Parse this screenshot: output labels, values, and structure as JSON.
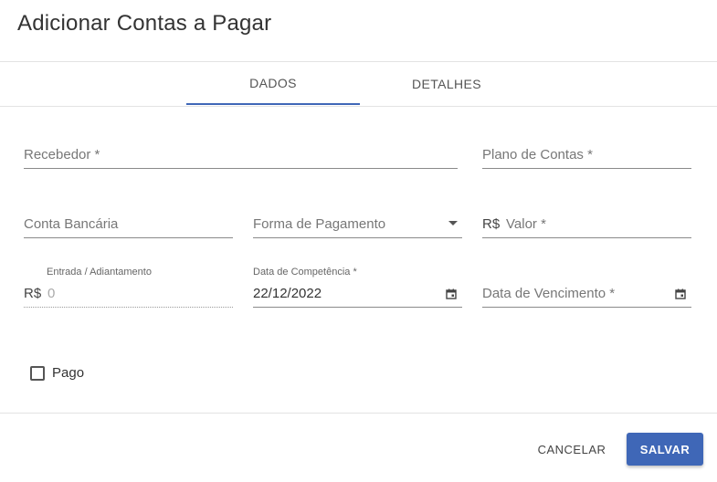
{
  "dialog": {
    "title": "Adicionar Contas a Pagar"
  },
  "tabs": [
    {
      "label": "DADOS",
      "active": true
    },
    {
      "label": "DETALHES",
      "active": false
    }
  ],
  "form": {
    "recebedor": {
      "label": "Recebedor *",
      "value": ""
    },
    "plano_contas": {
      "label": "Plano de Contas *",
      "value": ""
    },
    "conta_bancaria": {
      "label": "Conta Bancária",
      "value": ""
    },
    "forma_pagamento": {
      "label": "Forma de Pagamento",
      "value": ""
    },
    "valor": {
      "prefix": "R$",
      "label": "Valor *",
      "value": ""
    },
    "entrada": {
      "label": "Entrada / Adiantamento",
      "prefix": "R$",
      "value": "0"
    },
    "data_competencia": {
      "label": "Data de Competência *",
      "value": "22/12/2022"
    },
    "data_vencimento": {
      "label": "Data de Vencimento *",
      "value": ""
    },
    "pago": {
      "label": "Pago",
      "checked": false
    }
  },
  "actions": {
    "cancel_label": "CANCELAR",
    "save_label": "SALVAR"
  },
  "colors": {
    "accent": "#3f67b7"
  },
  "icons": {
    "calendar": "calendar-icon",
    "dropdown": "caret-down-icon"
  }
}
